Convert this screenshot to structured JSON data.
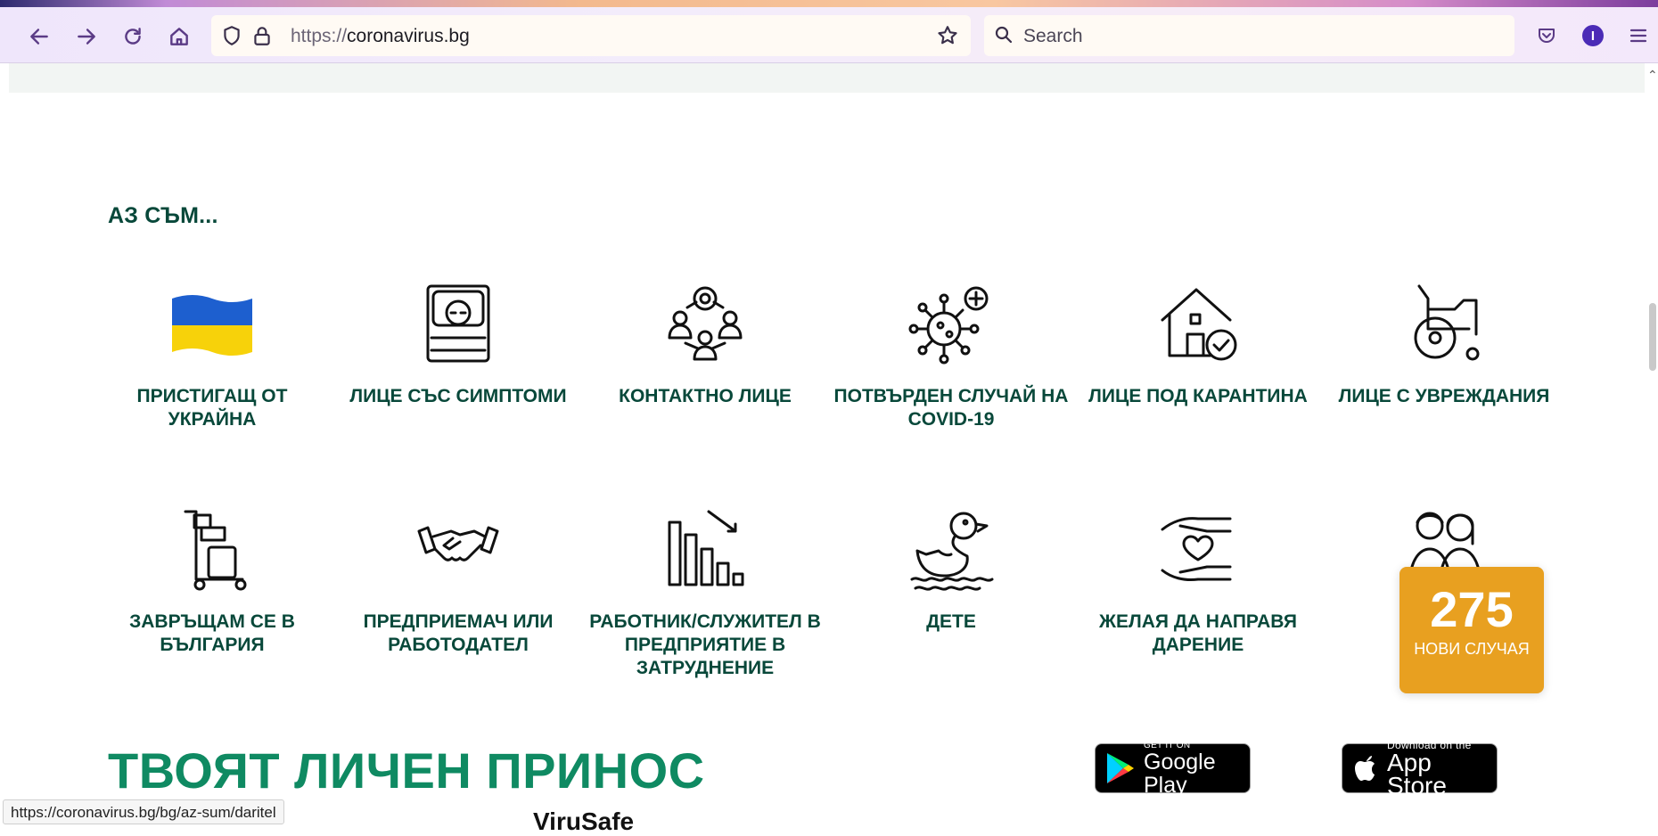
{
  "browser": {
    "url_protocol": "https://",
    "url_host": "coronavirus.bg",
    "search_placeholder": "Search",
    "profile_initial": "I",
    "status_url": "https://coronavirus.bg/bg/az-sum/daritel"
  },
  "section": {
    "title": "АЗ СЪМ...",
    "cards": [
      {
        "label": "ПРИСТИГАЩ ОТ УКРАЙНА",
        "icon": "ukraine-flag-icon"
      },
      {
        "label": "ЛИЦЕ СЪС СИМПТОМИ",
        "icon": "sick-person-bed-icon"
      },
      {
        "label": "КОНТАКТНО ЛИЦЕ",
        "icon": "contact-network-icon"
      },
      {
        "label": "ПОТВЪРДЕН СЛУЧАЙ НА COVID-19",
        "icon": "virus-icon"
      },
      {
        "label": "ЛИЦЕ ПОД КАРАНТИНА",
        "icon": "house-check-icon"
      },
      {
        "label": "ЛИЦЕ С УВРЕЖДАНИЯ",
        "icon": "wheelchair-icon"
      },
      {
        "label": "ЗАВРЪЩАМ СЕ В БЪЛГАРИЯ",
        "icon": "luggage-trolley-icon"
      },
      {
        "label": "ПРЕДПРИЕМАЧ ИЛИ РАБОТОДАТЕЛ",
        "icon": "handshake-icon"
      },
      {
        "label": "РАБОТНИК/СЛУЖИТЕЛ В ПРЕДПРИЯТИЕ В ЗАТРУДНЕНИЕ",
        "icon": "declining-chart-icon"
      },
      {
        "label": "ДЕТЕ",
        "icon": "duck-icon"
      },
      {
        "label": "ЖЕЛАЯ ДА НАПРАВЯ ДАРЕНИЕ",
        "icon": "donation-hands-icon"
      },
      {
        "label": "",
        "icon": "family-icon"
      }
    ]
  },
  "cases_widget": {
    "count": "275",
    "label": "НОВИ СЛУЧАЯ"
  },
  "promo": {
    "title": "ТВОЯТ ЛИЧЕН ПРИНОС",
    "google_play_small": "GET IT ON",
    "google_play_big": "Google Play",
    "app_store_small": "Download on the",
    "app_store_big": "App Store",
    "cutoff_text": "ViruSafe"
  },
  "colors": {
    "heading": "#08483a",
    "promo": "#0f8a62",
    "cases_bg": "#e8a020"
  }
}
